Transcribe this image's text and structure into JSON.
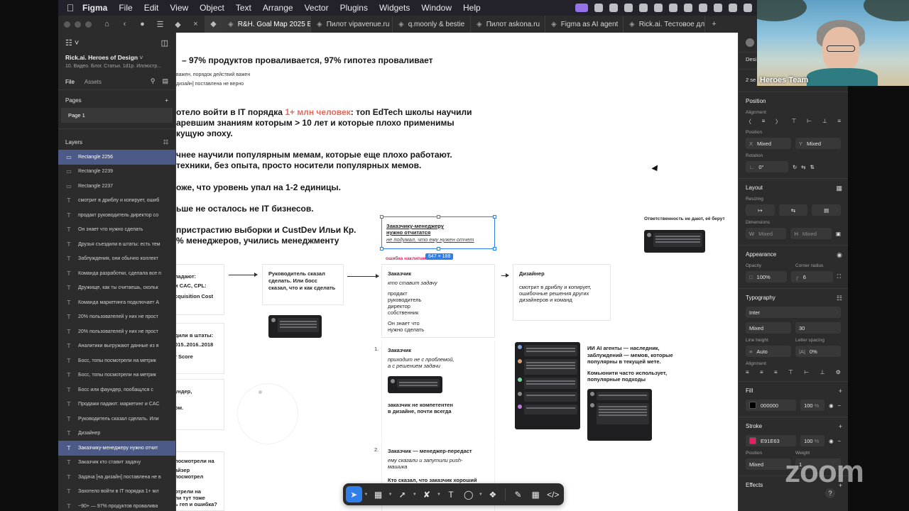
{
  "menubar": {
    "app": "Figma",
    "items": [
      "File",
      "Edit",
      "View",
      "Object",
      "Text",
      "Arrange",
      "Vector",
      "Plugins",
      "Widgets",
      "Window",
      "Help"
    ]
  },
  "tabs": [
    {
      "label": "R&H. Goal Map 2025 Без тике",
      "active": true
    },
    {
      "label": "Пилот vipavenue.ru",
      "active": false
    },
    {
      "label": "q.moonly & bestie",
      "active": false
    },
    {
      "label": "Пилот askona.ru",
      "active": false
    },
    {
      "label": "Figma as AI agent",
      "active": false
    },
    {
      "label": "Rick.ai. Тестовое для проду",
      "active": false
    }
  ],
  "left_panel": {
    "project_name": "Rick.ai. Heroes of Design",
    "project_sub": "10. Видео. Блог. Статьи. 1d1p. Иллюстр...",
    "tab_file": "File",
    "tab_assets": "Assets",
    "pages_title": "Pages",
    "page_1": "Page 1",
    "layers_title": "Layers",
    "layers": [
      {
        "type": "rect",
        "name": "Rectangle 2256",
        "selected": true
      },
      {
        "type": "rect",
        "name": "Rectangle 2239",
        "selected": false
      },
      {
        "type": "rect",
        "name": "Rectangle 2237",
        "selected": false
      },
      {
        "type": "text",
        "name": "смотрит в дриблу и копирует, ошиб",
        "selected": false
      },
      {
        "type": "text",
        "name": "продакт руководитель директор со",
        "selected": false
      },
      {
        "type": "text",
        "name": "Он знает что нужно сделать",
        "selected": false
      },
      {
        "type": "text",
        "name": "Друзья съездили в штаты: есть тем",
        "selected": false
      },
      {
        "type": "text",
        "name": "Заблуждения, они обычно коллект",
        "selected": false
      },
      {
        "type": "text",
        "name": "Команда разработки, сделала все п",
        "selected": false
      },
      {
        "type": "text",
        "name": "Дружище, как ты считаешь, скольк",
        "selected": false
      },
      {
        "type": "text",
        "name": "Команда маркетинга подключает А",
        "selected": false
      },
      {
        "type": "text",
        "name": "20% пользователей у них не прост",
        "selected": false
      },
      {
        "type": "text",
        "name": "20% пользователей у них не прост",
        "selected": false
      },
      {
        "type": "text",
        "name": "Аналитики выгружают данные из я",
        "selected": false
      },
      {
        "type": "text",
        "name": "Босс, топы посмотрели на метрик",
        "selected": false
      },
      {
        "type": "text",
        "name": "Босс, топы посмотрели на метрик",
        "selected": false
      },
      {
        "type": "text",
        "name": "Босс или фаундер, пообащлся с",
        "selected": false
      },
      {
        "type": "text",
        "name": "Продажи падают: маркетинг и CAC",
        "selected": false
      },
      {
        "type": "text",
        "name": "Руководитель сказал сделать. Или",
        "selected": false
      },
      {
        "type": "text",
        "name": "Дизайнер",
        "selected": false
      },
      {
        "type": "text",
        "name": "Заказчику-менеджеру нужно отчит",
        "selected": true
      },
      {
        "type": "text",
        "name": "Заказчик кто ставит задачу",
        "selected": false
      },
      {
        "type": "text",
        "name": "Задача [на дизайн] поставлена не в",
        "selected": false
      },
      {
        "type": "text",
        "name": "Захотело войти в IT порядка 1+ мл",
        "selected": false
      },
      {
        "type": "text",
        "name": "~90+ — 97% продуктов провалива",
        "selected": false
      }
    ]
  },
  "canvas": {
    "line1": "– 97% продуктов проваливается, 97% гипотез проваливает",
    "line2a": "важен, порядок действий важен",
    "line2b": "дизайн] поставлена не верно",
    "p1_pre": "отело войти в IT порядка ",
    "p1_hl": "1+ млн человек",
    "p1_post": ": топ EdTech школы научили",
    "p1_l2": "аревшим знаниям которым > 10 лет и которые плохо применимы",
    "p1_l3": "кущую эпоху.",
    "p2_l1": "чнее научили популярным мемам, которые еще плохо работают.",
    "p2_l2": "техники, без опыта, просто носители популярных мемов.",
    "p3": "оже, что уровень упал на 1-2 единицы.",
    "p4": "ьше не осталось не IT бизнесов.",
    "p5_l1": "пристрастию выборки и CustDev Ильи Кр.",
    "p5_l2": "% менеджеров, учились менеджменту",
    "resp_title": "Ответственность не дают, её берут",
    "sel_title": "Заказчику-менеджеру нужно отчитатся",
    "sel_sub": "не подумал, что ему нужен отчет",
    "sel_dim": "647 × 188",
    "red_label": "ошибка наклипан",
    "c_left_a": "падают:",
    "c_left_b": "и CAC, CPL:",
    "c_left_c": "cquisition Cost",
    "c_ruk_title": "Руководитель сказал сделать. Или босс сказал, что и как сделать",
    "c_zak_title": "Заказчик",
    "c_zak_sub": "кто ставит задачу",
    "c_zak_l1": "продакт",
    "c_zak_l2": "руководитель",
    "c_zak_l3": "директор",
    "c_zak_l4": "собственник",
    "c_zak_l5": "Он знает что",
    "c_zak_l6": "нужно сделать",
    "c_dis_title": "Дизайнер",
    "c_dis_text": "смотрит в дриблу и копирует, ошибочные решения других дизайнеров и команд",
    "c_mid_a": "дили в штаты:",
    "c_mid_b": "015..2016..2018",
    "c_mid_c": "r Score",
    "c_mid2_a": "ундер,",
    "c_mid2_b": "ом.",
    "n1": "1.",
    "c1_title": "Заказчик",
    "c1_sub1": "приходит не с проблемой,",
    "c1_sub2": "а с решением задачи",
    "c1_b1": "заказчик не компетентен",
    "c1_b2": "в дизайне, почти всегда",
    "ai_l1": "ИИ AI агенты — наследник,",
    "ai_l2": "заблуждений — мемов, которые",
    "ai_l3": "популярны в текущей мете.",
    "ai_l4": "Комьюнити часто использует,",
    "ai_l5": "популярные подходы",
    "n2": "2.",
    "c2_title": "Заказчик — менеджер-передаст",
    "c2_sub1": "ему сказали и запутили push-",
    "c2_sub2": "машика",
    "c2_b1": "Кто сказал, что заказчик хороший",
    "b_left1": "посмотрели на",
    "b_left2": "айзер посмотрел",
    "b_left3": "отрели на",
    "b_left4": "ли тут тоже",
    "b_left5": "ь геп и ошибка?"
  },
  "right_panel": {
    "tab": "Desi",
    "sel_count": "2 se",
    "position_title": "Position",
    "alignment_label": "Alignment",
    "position_label": "Position",
    "x_label": "X",
    "x_value": "Mixed",
    "y_label": "Y",
    "y_value": "Mixed",
    "rotation_label": "Rotation",
    "rotation_value": "0°",
    "layout_title": "Layout",
    "resizing_label": "Resizing",
    "dimensions_label": "Dimensions",
    "w_label": "W",
    "w_value": "Mixed",
    "h_label": "H",
    "h_value": "Mixed",
    "appearance_title": "Appearance",
    "opacity_label": "Opacity",
    "opacity_value": "100%",
    "corner_label": "Corner radius",
    "corner_value": "6",
    "typography_title": "Typography",
    "font_family": "Inter",
    "font_weight": "Mixed",
    "font_size": "30",
    "line_height_label": "Line height",
    "line_height_value": "Auto",
    "letter_spacing_label": "Letter spacing",
    "letter_spacing_value": "0%",
    "alignment2_label": "Alignment",
    "fill_title": "Fill",
    "fill_hex": "000000",
    "fill_opacity": "100",
    "fill_color": "#000000",
    "stroke_title": "Stroke",
    "stroke_hex": "E91E63",
    "stroke_opacity": "100",
    "stroke_color": "#E91E63",
    "stroke_position_label": "Position",
    "stroke_weight_label": "Weight",
    "stroke_position": "Mixed",
    "stroke_weight": "1",
    "effects_title": "Effects",
    "pct": "%"
  },
  "webcam": {
    "label": "Heroes Team"
  },
  "watermark": "zoom",
  "help": "?",
  "colors": {
    "accent": "#2f7fea",
    "highlight": "#e5695a"
  }
}
